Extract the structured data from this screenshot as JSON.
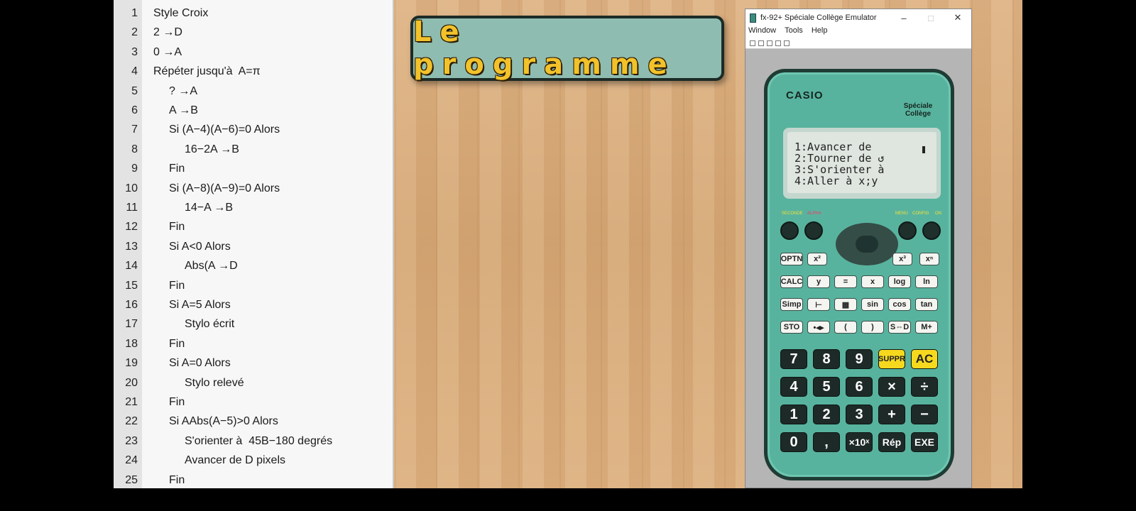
{
  "listing": {
    "lines": [
      {
        "n": "1",
        "text": "Style Croix",
        "indent": 0
      },
      {
        "n": "2",
        "text": "2 →D",
        "indent": 0
      },
      {
        "n": "3",
        "text": "0 →A",
        "indent": 0
      },
      {
        "n": "4",
        "text": "Répéter jusqu'à  A=π",
        "indent": 0
      },
      {
        "n": "5",
        "text": "? →A",
        "indent": 1
      },
      {
        "n": "6",
        "text": "A →B",
        "indent": 1
      },
      {
        "n": "7",
        "text": "Si (A−4)(A−6)=0 Alors",
        "indent": 1
      },
      {
        "n": "8",
        "text": "16−2A →B",
        "indent": 2
      },
      {
        "n": "9",
        "text": "Fin",
        "indent": 1
      },
      {
        "n": "10",
        "text": "Si (A−8)(A−9)=0 Alors",
        "indent": 1
      },
      {
        "n": "11",
        "text": "14−A →B",
        "indent": 2
      },
      {
        "n": "12",
        "text": "Fin",
        "indent": 1
      },
      {
        "n": "13",
        "text": "Si A<0 Alors",
        "indent": 1
      },
      {
        "n": "14",
        "text": "Abs(A →D",
        "indent": 2
      },
      {
        "n": "15",
        "text": "Fin",
        "indent": 1
      },
      {
        "n": "16",
        "text": "Si A=5 Alors",
        "indent": 1
      },
      {
        "n": "17",
        "text": "Stylo écrit",
        "indent": 2
      },
      {
        "n": "18",
        "text": "Fin",
        "indent": 1
      },
      {
        "n": "19",
        "text": "Si A=0 Alors",
        "indent": 1
      },
      {
        "n": "20",
        "text": "Stylo relevé",
        "indent": 2
      },
      {
        "n": "21",
        "text": "Fin",
        "indent": 1
      },
      {
        "n": "22",
        "text": "Si AAbs(A−5)>0 Alors",
        "indent": 1
      },
      {
        "n": "23",
        "text": "S'orienter à  45B−180 degrés",
        "indent": 2
      },
      {
        "n": "24",
        "text": "Avancer de D pixels",
        "indent": 2
      },
      {
        "n": "25",
        "text": "Fin",
        "indent": 1
      }
    ]
  },
  "slide": {
    "title": "Le programme"
  },
  "emulator": {
    "window_title": "fx-92+ Spéciale Collège Emulator",
    "menu": [
      "Window",
      "Tools",
      "Help"
    ],
    "window_buttons": {
      "minimize": "–",
      "maximize": "□",
      "close": "✕"
    },
    "calculator": {
      "brand": "CASIO",
      "edition_line1": "Spéciale",
      "edition_line2": "Collège",
      "screen_lines": [
        "1:Avancer de",
        "2:Tourner de ↺",
        "3:S'orienter à",
        "4:Aller à x;y"
      ],
      "top_labels": {
        "second": "SECONDE",
        "alpha": "ALPHA",
        "menu": "MENU",
        "config": "CONFIG",
        "on": "ON"
      },
      "function_rows": [
        [
          "OPTN",
          "x²",
          "x³",
          "xⁿ"
        ],
        [
          "CALC",
          "y",
          "=",
          "x",
          "log",
          "ln"
        ],
        [
          "Simp",
          "⊢",
          "▦",
          "sin",
          "cos",
          "tan"
        ],
        [
          "STO",
          "•◂▸",
          "(",
          ")",
          "S⇔D",
          "M+"
        ]
      ],
      "number_rows": [
        [
          "7",
          "8",
          "9",
          "SUPPR",
          "AC"
        ],
        [
          "4",
          "5",
          "6",
          "×",
          "÷"
        ],
        [
          "1",
          "2",
          "3",
          "+",
          "−"
        ],
        [
          "0",
          ",",
          "×10ˣ",
          "Rép",
          "EXE"
        ]
      ]
    }
  },
  "colors": {
    "calculator_body": "#58b39e",
    "title_text": "#f2c22b",
    "title_panel": "#8fbcb0",
    "yellow_key": "#f6d91e"
  }
}
